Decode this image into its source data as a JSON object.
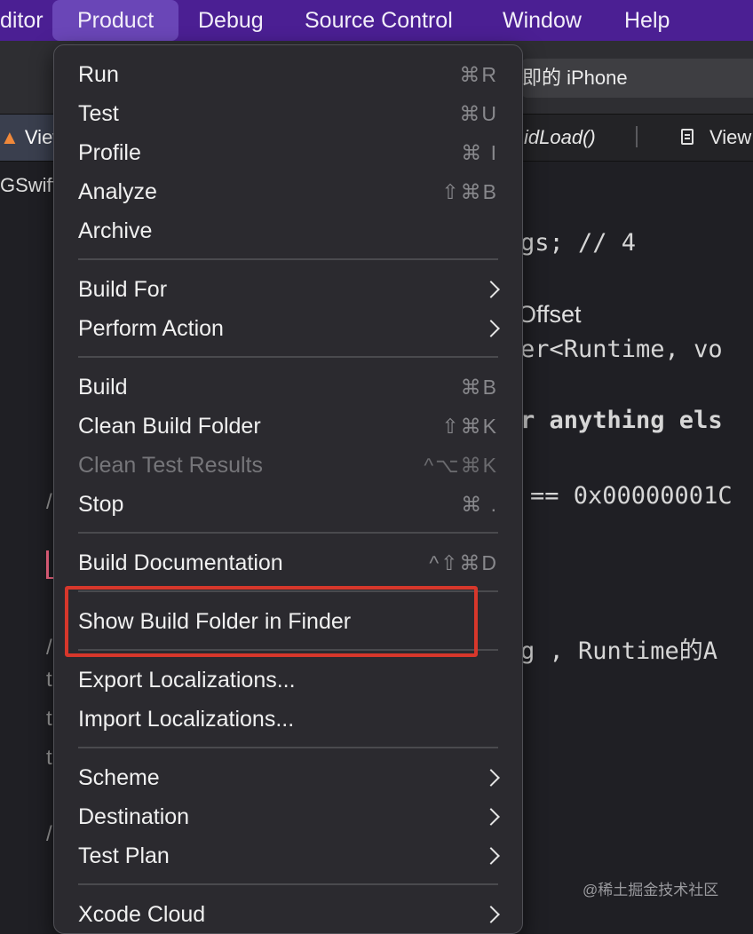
{
  "menubar": {
    "items": [
      "ditor",
      "Product",
      "Debug",
      "Source Control",
      "Window",
      "Help"
    ]
  },
  "toolbar": {
    "device": "即的 iPhone"
  },
  "tabs": {
    "active_tab": "View",
    "method": "idLoad()",
    "doc_tab": "View"
  },
  "breadcrumb": "GSwift",
  "code": {
    "lines": [
      "gs; // 4",
      "Offset",
      "er<Runtime, vo",
      "r anything els",
      "== 0x00000001C",
      "g , Runtime的A"
    ],
    "gutter": [
      "/",
      "/",
      "t",
      "t",
      "t",
      "/"
    ]
  },
  "menu": {
    "run": "Run",
    "run_sc": "⌘R",
    "test": "Test",
    "test_sc": "⌘U",
    "profile": "Profile",
    "profile_sc": "⌘ I",
    "analyze": "Analyze",
    "analyze_sc": "⇧⌘B",
    "archive": "Archive",
    "build_for": "Build For",
    "perform_action": "Perform Action",
    "build": "Build",
    "build_sc": "⌘B",
    "clean_build_folder": "Clean Build Folder",
    "clean_build_folder_sc": "⇧⌘K",
    "clean_test_results": "Clean Test Results",
    "clean_test_results_sc": "^⌥⌘K",
    "stop": "Stop",
    "stop_sc": "⌘ .",
    "build_documentation": "Build Documentation",
    "build_documentation_sc": "^⇧⌘D",
    "show_build_folder": "Show Build Folder in Finder",
    "export_localizations": "Export Localizations...",
    "import_localizations": "Import Localizations...",
    "scheme": "Scheme",
    "destination": "Destination",
    "test_plan": "Test Plan",
    "xcode_cloud": "Xcode Cloud"
  },
  "watermark": "@稀土掘金技术社区",
  "colors": {
    "menubar_bg": "#4b1f93",
    "menu_bg": "#2b2a2f",
    "highlight_border": "#d7372b"
  }
}
